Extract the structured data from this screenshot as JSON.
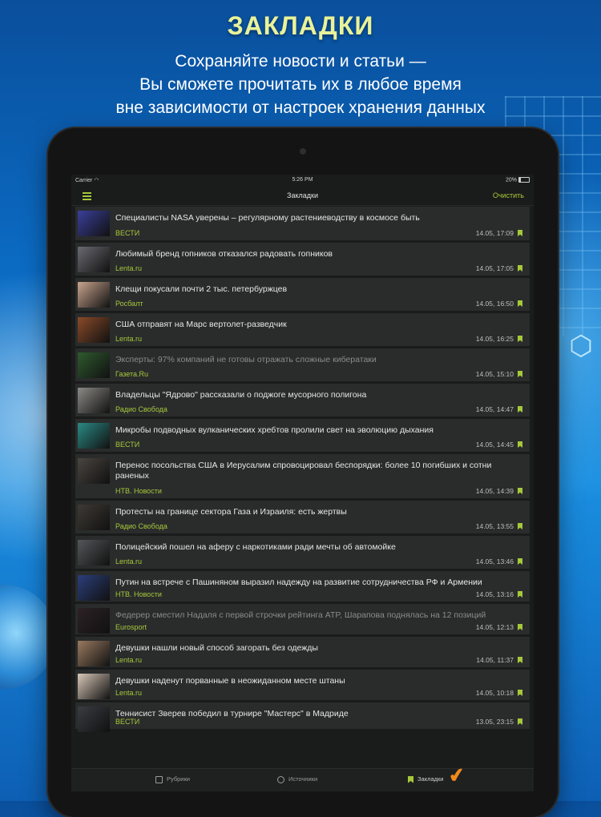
{
  "promo": {
    "title": "ЗАКЛАДКИ",
    "subtitle_lines": [
      "Сохраняйте новости и статьи —",
      "Вы сможете прочитать их в любое время",
      "вне зависимости от настроек хранения данных"
    ]
  },
  "status": {
    "carrier": "Carrier",
    "time": "5:26 PM",
    "battery": "20%"
  },
  "nav": {
    "title": "Закладки",
    "clear": "Очистить"
  },
  "items": [
    {
      "title": "Специалисты NASA уверены – регулярному растениеводству в космосе быть",
      "source": "ВЕСТИ",
      "date": "14.05, 17:09",
      "read": false,
      "thumb": "#3a3f9a"
    },
    {
      "title": "Любимый бренд гопников отказался радовать гопников",
      "source": "Lenta.ru",
      "date": "14.05, 17:05",
      "read": false,
      "thumb": "#6a6a72"
    },
    {
      "title": "Клещи покусали почти 2 тыс. петербуржцев",
      "source": "Росбалт",
      "date": "14.05, 16:50",
      "read": false,
      "thumb": "#c9a48d"
    },
    {
      "title": "США отправят на Марс вертолет-разведчик",
      "source": "Lenta.ru",
      "date": "14.05, 16:25",
      "read": false,
      "thumb": "#8a4a28"
    },
    {
      "title": "Эксперты: 97% компаний не готовы отражать сложные кибератаки",
      "source": "Газета.Ru",
      "date": "14.05, 15:10",
      "read": true,
      "thumb": "#2e5a2e"
    },
    {
      "title": "Владельцы \"Ядрово\" рассказали о поджоге мусорного полигона",
      "source": "Радио Свобода",
      "date": "14.05, 14:47",
      "read": false,
      "thumb": "#8c8a86"
    },
    {
      "title": "Микробы подводных вулканических хребтов пролили свет на эволюцию дыхания",
      "source": "ВЕСТИ",
      "date": "14.05, 14:45",
      "read": false,
      "thumb": "#2a8a84"
    },
    {
      "title": "Перенос посольства США в Иерусалим спровоцировал беспорядки: более 10 погибших и сотни раненых",
      "source": "НТВ. Новости",
      "date": "14.05, 14:39",
      "read": false,
      "thumb": "#4a4540"
    },
    {
      "title": "Протесты на границе сектора Газа и Израиля: есть жертвы",
      "source": "Радио Свобода",
      "date": "14.05, 13:55",
      "read": false,
      "thumb": "#3f3a34"
    },
    {
      "title": "Полицейский пошел на аферу с наркотиками ради мечты об автомойке",
      "source": "Lenta.ru",
      "date": "14.05, 13:46",
      "read": false,
      "thumb": "#55565a"
    },
    {
      "title": "Путин на встрече с Пашиняном выразил надежду на развитие сотрудничества РФ и Армении",
      "source": "НТВ. Новости",
      "date": "14.05, 13:16",
      "read": false,
      "thumb": "#2b3e7a"
    },
    {
      "title": "Федерер сместил Надаля с первой строчки рейтинга ATP, Шарапова поднялась на 12 позиций",
      "source": "Eurosport",
      "date": "14.05, 12:13",
      "read": true,
      "thumb": "#2c2226"
    },
    {
      "title": "Девушки нашли новый способ загорать без одежды",
      "source": "Lenta.ru",
      "date": "14.05, 11:37",
      "read": false,
      "thumb": "#9a7a60"
    },
    {
      "title": "Девушки наденут порванные в неожиданном месте штаны",
      "source": "Lenta.ru",
      "date": "14.05, 10:18",
      "read": false,
      "thumb": "#d8c8b8"
    },
    {
      "title": "Теннисист Зверев победил в турнире \"Мастерс\" в Мадриде",
      "source": "ВЕСТИ",
      "date": "13.05, 23:15",
      "read": false,
      "thumb": "#3a3c42"
    }
  ],
  "tabs": {
    "rubrics": "Рубрики",
    "sources": "Источники",
    "bookmarks": "Закладки"
  },
  "colors": {
    "accent": "#a6c83a",
    "check": "#f08a1c"
  },
  "icons": [
    "menu-icon",
    "wifi-icon",
    "battery-icon",
    "bookmark-icon",
    "rubrics-icon",
    "sources-icon",
    "checkmark-icon"
  ]
}
